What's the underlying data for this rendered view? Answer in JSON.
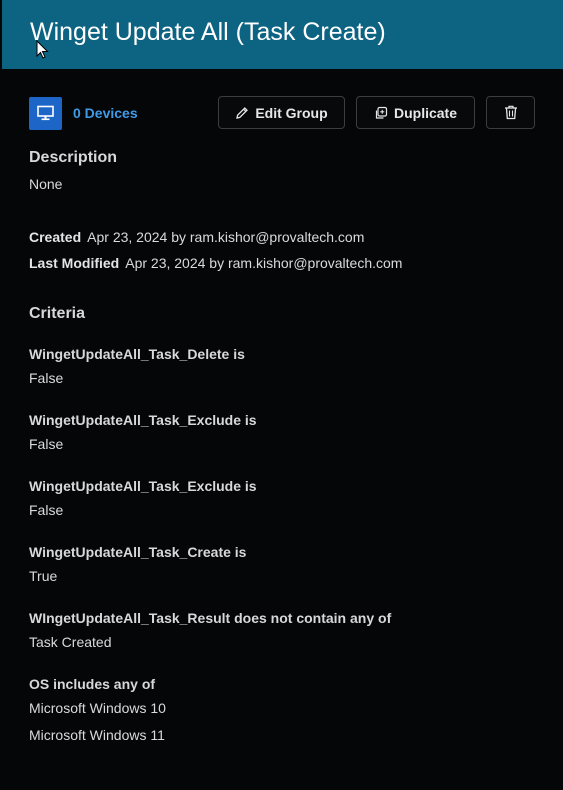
{
  "header": {
    "title": "Winget Update All (Task Create)"
  },
  "toolbar": {
    "devices_label": "0 Devices",
    "edit_group_label": "Edit Group",
    "duplicate_label": "Duplicate"
  },
  "description": {
    "heading": "Description",
    "value": "None"
  },
  "meta": {
    "created_label": "Created",
    "created_value": "Apr 23, 2024 by ram.kishor@provaltech.com",
    "modified_label": "Last Modified",
    "modified_value": "Apr 23, 2024 by ram.kishor@provaltech.com"
  },
  "criteria": {
    "heading": "Criteria",
    "items": [
      {
        "label": "WingetUpdateAll_Task_Delete is",
        "values": [
          "False"
        ]
      },
      {
        "label": "WingetUpdateAll_Task_Exclude is",
        "values": [
          "False"
        ]
      },
      {
        "label": "WingetUpdateAll_Task_Exclude is",
        "values": [
          "False"
        ]
      },
      {
        "label": "WingetUpdateAll_Task_Create is",
        "values": [
          "True"
        ]
      },
      {
        "label": "WIngetUpdateAll_Task_Result does not contain any of",
        "values": [
          "Task Created"
        ]
      },
      {
        "label": "OS includes any of",
        "values": [
          "Microsoft Windows 10",
          "Microsoft Windows 11"
        ]
      }
    ]
  },
  "colors": {
    "header_bg": "#0d6382",
    "accent_link": "#3f9be8",
    "device_icon_bg": "#1d66c7",
    "page_bg": "#050608"
  },
  "icons": [
    "monitor-icon",
    "pencil-icon",
    "duplicate-icon",
    "trash-icon",
    "mouse-cursor-icon"
  ]
}
